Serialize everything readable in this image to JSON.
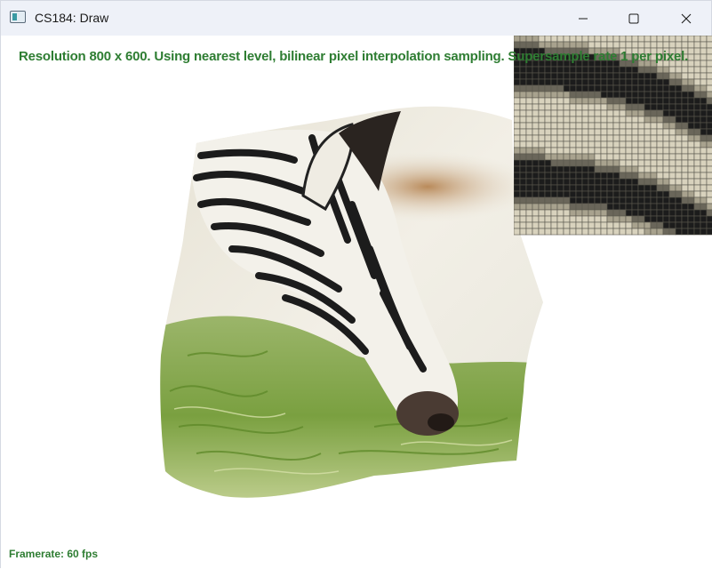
{
  "window": {
    "title": "CS184: Draw",
    "controls": {
      "minimize_icon": "minimize-icon",
      "maximize_icon": "maximize-icon",
      "close_icon": "close-icon"
    }
  },
  "canvas": {
    "status_text": "Resolution 800 x 600. Using nearest level, bilinear pixel interpolation sampling. Supersample rate 1 per pixel.",
    "framerate_text": "Framerate: 60 fps",
    "status_color": "#2e7d32",
    "image_subject": "zebra grazing on grass",
    "zoom_inset": "pixel zoom of zebra stripes"
  }
}
